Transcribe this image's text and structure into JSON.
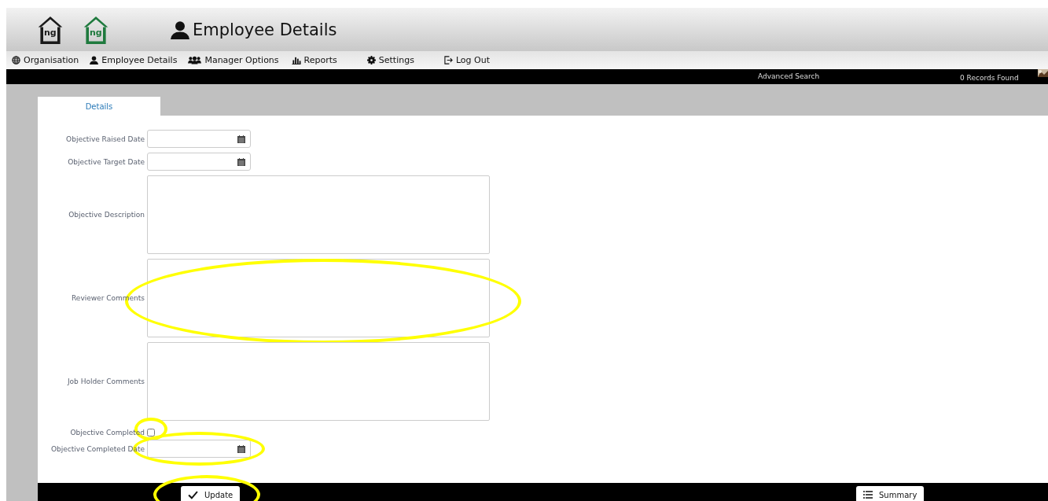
{
  "header": {
    "logos": [
      {
        "text": "ng",
        "color": "#1a1a1a"
      },
      {
        "text": "ng",
        "color": "#1f7a3e"
      }
    ],
    "title": "Employee Details"
  },
  "nav": [
    {
      "label": "Organisation"
    },
    {
      "label": "Employee Details"
    },
    {
      "label": "Manager Options"
    },
    {
      "label": "Reports"
    },
    {
      "label": "Settings"
    },
    {
      "label": "Log Out"
    }
  ],
  "toolbar": {
    "advanced_search": "Advanced Search",
    "records": "0 Records Found"
  },
  "tabs": [
    {
      "label": "Details",
      "selected": true
    }
  ],
  "fields": [
    {
      "kind": "date",
      "label": "Objective Raised Date",
      "highlighted": false
    },
    {
      "kind": "date",
      "label": "Objective Target Date",
      "highlighted": false
    },
    {
      "kind": "textarea",
      "label": "Objective Description",
      "highlighted": false
    },
    {
      "kind": "textarea",
      "label": "Reviewer Comments",
      "highlighted": true
    },
    {
      "kind": "textarea",
      "label": "Job Holder Comments",
      "highlighted": false
    },
    {
      "kind": "checkbox",
      "label": "Objective Completed",
      "checked": false,
      "highlighted": true
    },
    {
      "kind": "date",
      "label": "Objective Completed Date",
      "highlighted": true
    }
  ],
  "footer": {
    "update": {
      "label": "Update",
      "highlighted": true
    },
    "summary": {
      "label": "Summary"
    }
  }
}
